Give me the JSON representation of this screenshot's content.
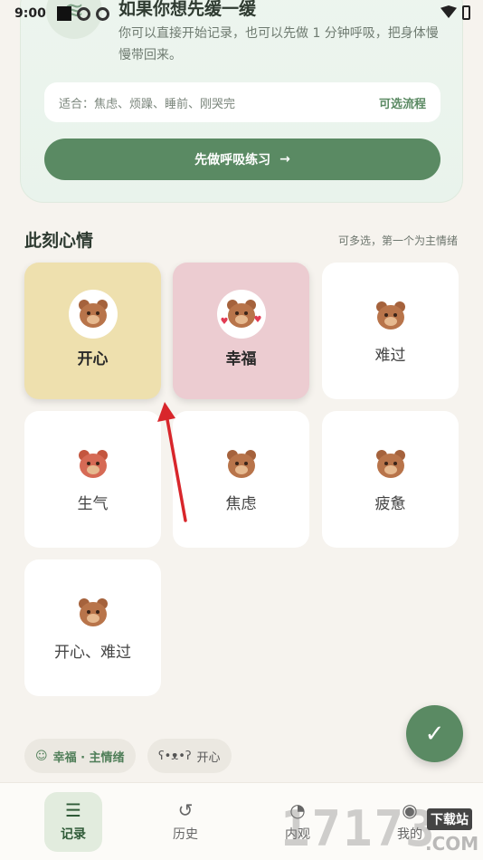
{
  "status_bar": {
    "time": "9:00"
  },
  "intro_card": {
    "title": "如果你想先缓一缓",
    "description": "你可以直接开始记录，也可以先做 1 分钟呼吸，把身体慢慢带回来。",
    "suitable_label": "适合：焦虑、烦躁、睡前、刚哭完",
    "optional_flow": "可选流程",
    "breathing_button": "先做呼吸练习",
    "arrow_glyph": "→"
  },
  "mood_section": {
    "title": "此刻心情",
    "hint": "可多选，第一个为主情绪",
    "moods": [
      {
        "label": "开心",
        "selected": true,
        "color": "#eee0ae"
      },
      {
        "label": "幸福",
        "selected": true,
        "color": "#ecccd1"
      },
      {
        "label": "难过",
        "selected": false
      },
      {
        "label": "生气",
        "selected": false
      },
      {
        "label": "焦虑",
        "selected": false
      },
      {
        "label": "疲惫",
        "selected": false
      },
      {
        "label": "开心、难过",
        "selected": false
      }
    ]
  },
  "confirm_fab": {
    "icon": "check-icon",
    "glyph": "✓"
  },
  "selected_chips": [
    {
      "text": "幸福 · 主情绪",
      "primary": true
    },
    {
      "text": "开心",
      "primary": false
    }
  ],
  "bottom_nav": {
    "items": [
      {
        "label": "记录",
        "icon": "edit-list-icon",
        "active": true
      },
      {
        "label": "历史",
        "icon": "history-icon",
        "active": false
      },
      {
        "label": "内观",
        "icon": "insight-icon",
        "active": false
      },
      {
        "label": "我的",
        "icon": "profile-icon",
        "active": false
      }
    ]
  },
  "watermark": {
    "numbers": "17173",
    "tag": "下载站",
    "domain": ".COM"
  },
  "colors": {
    "accent": "#5a8a63",
    "background": "#f6f3ee",
    "annotation_arrow": "#d8262b"
  }
}
